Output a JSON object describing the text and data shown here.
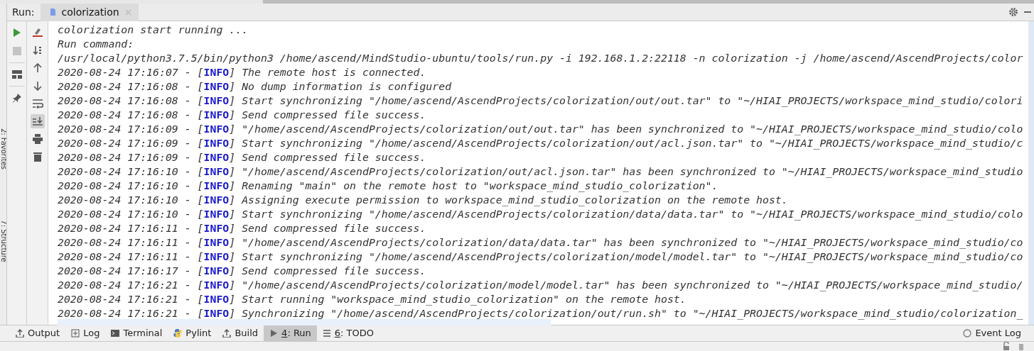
{
  "run_panel": {
    "label": "Run:",
    "tabs": [
      {
        "label": "colorization",
        "selected": true
      }
    ]
  },
  "side_stripes": [
    {
      "label": "2: Favorites"
    },
    {
      "label": "7: Structure"
    }
  ],
  "console_toolbar": {
    "scroll_to_end": {
      "on": true
    }
  },
  "console": {
    "lines": [
      {
        "kind": "plain",
        "text": "colorization start running ..."
      },
      {
        "kind": "plain",
        "text": "Run command:"
      },
      {
        "kind": "plain",
        "text": "/usr/local/python3.7.5/bin/python3 /home/ascend/MindStudio-ubuntu/tools/run.py -i 192.168.1.2:22118 -n colorization -j /home/ascend/AscendProjects/color"
      },
      {
        "kind": "log",
        "text": "2020-08-24 17:16:07 - [**INFO**] The remote host is connected."
      },
      {
        "kind": "log",
        "text": "2020-08-24 17:16:08 - [**INFO**] No dump information is configured"
      },
      {
        "kind": "log",
        "text": "2020-08-24 17:16:08 - [**INFO**] Start synchronizing \"/home/ascend/AscendProjects/colorization/out/out.tar\" to \"~/HIAI_PROJECTS/workspace_mind_studio/colori"
      },
      {
        "kind": "log",
        "text": "2020-08-24 17:16:08 - [**INFO**] Send compressed file success."
      },
      {
        "kind": "log",
        "text": "2020-08-24 17:16:09 - [**INFO**] \"/home/ascend/AscendProjects/colorization/out/out.tar\" has been synchronized to \"~/HIAI_PROJECTS/workspace_mind_studio/colo"
      },
      {
        "kind": "log",
        "text": "2020-08-24 17:16:09 - [**INFO**] Start synchronizing \"/home/ascend/AscendProjects/colorization/out/acl.json.tar\" to \"~/HIAI_PROJECTS/workspace_mind_studio/c"
      },
      {
        "kind": "log",
        "text": "2020-08-24 17:16:09 - [**INFO**] Send compressed file success."
      },
      {
        "kind": "log",
        "text": "2020-08-24 17:16:10 - [**INFO**] \"/home/ascend/AscendProjects/colorization/out/acl.json.tar\" has been synchronized to \"~/HIAI_PROJECTS/workspace_mind_studio"
      },
      {
        "kind": "log",
        "text": "2020-08-24 17:16:10 - [**INFO**] Renaming \"main\" on the remote host to \"workspace_mind_studio_colorization\"."
      },
      {
        "kind": "log",
        "text": "2020-08-24 17:16:10 - [**INFO**] Assigning execute permission to workspace_mind_studio_colorization on the remote host."
      },
      {
        "kind": "log",
        "text": "2020-08-24 17:16:10 - [**INFO**] Start synchronizing \"/home/ascend/AscendProjects/colorization/data/data.tar\" to \"~/HIAI_PROJECTS/workspace_mind_studio/colo"
      },
      {
        "kind": "log",
        "text": "2020-08-24 17:16:11 - [**INFO**] Send compressed file success."
      },
      {
        "kind": "log",
        "text": "2020-08-24 17:16:11 - [**INFO**] \"/home/ascend/AscendProjects/colorization/data/data.tar\" has been synchronized to \"~/HIAI_PROJECTS/workspace_mind_studio/co"
      },
      {
        "kind": "log",
        "text": "2020-08-24 17:16:11 - [**INFO**] Start synchronizing \"/home/ascend/AscendProjects/colorization/model/model.tar\" to \"~/HIAI_PROJECTS/workspace_mind_studio/co"
      },
      {
        "kind": "log",
        "text": "2020-08-24 17:16:17 - [**INFO**] Send compressed file success."
      },
      {
        "kind": "log",
        "text": "2020-08-24 17:16:21 - [**INFO**] \"/home/ascend/AscendProjects/colorization/model/model.tar\" has been synchronized to \"~/HIAI_PROJECTS/workspace_mind_studio/"
      },
      {
        "kind": "log",
        "text": "2020-08-24 17:16:21 - [**INFO**] Start running \"workspace_mind_studio_colorization\" on the remote host."
      },
      {
        "kind": "log",
        "text": "2020-08-24 17:16:21 - [**INFO**] Synchronizing \"/home/ascend/AscendProjects/colorization/out/run.sh\" to \"~/HIAI_PROJECTS/workspace_mind_studio/colorization_"
      }
    ]
  },
  "tool_tabs": [
    {
      "kind": "output",
      "label": "Output",
      "selected": false,
      "mnemonic": false
    },
    {
      "kind": "log",
      "label": "Log",
      "selected": false,
      "mnemonic": false
    },
    {
      "kind": "terminal",
      "label": "Terminal",
      "selected": false,
      "mnemonic": false
    },
    {
      "kind": "pylint",
      "label": "Pylint",
      "selected": false,
      "mnemonic": false
    },
    {
      "kind": "build",
      "label": "Build",
      "selected": false,
      "mnemonic": false
    },
    {
      "kind": "run",
      "label": "4: Run",
      "selected": true,
      "mnemonic": true
    },
    {
      "kind": "todo",
      "label": "6: TODO",
      "selected": false,
      "mnemonic": true
    }
  ],
  "event_log": {
    "label": "Event Log"
  }
}
